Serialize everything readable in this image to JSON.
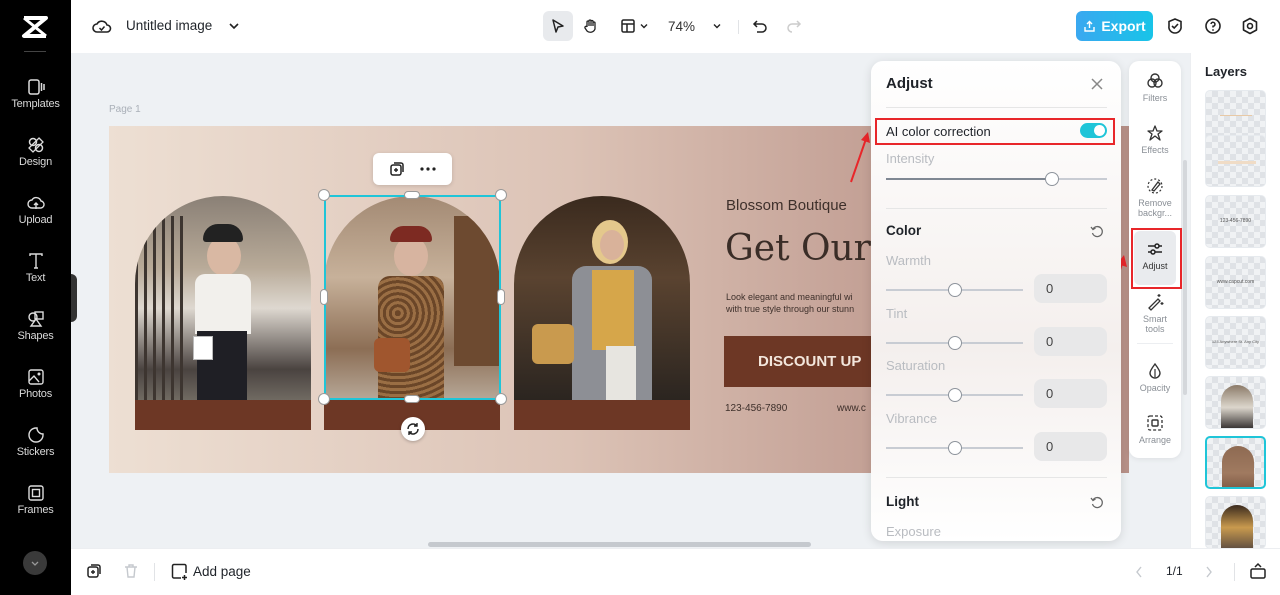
{
  "app": {
    "logo": "capcut-logo-icon"
  },
  "rail": {
    "items": [
      {
        "label": "Templates",
        "icon": "templates-icon"
      },
      {
        "label": "Design",
        "icon": "design-icon"
      },
      {
        "label": "Upload",
        "icon": "upload-cloud-icon"
      },
      {
        "label": "Text",
        "icon": "text-icon"
      },
      {
        "label": "Shapes",
        "icon": "shapes-icon"
      },
      {
        "label": "Photos",
        "icon": "photos-icon"
      },
      {
        "label": "Stickers",
        "icon": "stickers-icon"
      },
      {
        "label": "Frames",
        "icon": "frames-icon"
      }
    ]
  },
  "topbar": {
    "title": "Untitled image",
    "zoom": "74%",
    "export_label": "Export"
  },
  "canvas": {
    "page_label": "Page 1",
    "design": {
      "brand": "Blossom Boutique",
      "headline": "Get Our",
      "body_line1": "Look elegant and meaningful wi",
      "body_line2": "with true style through our stunn",
      "cta": "DISCOUNT UP",
      "phone": "123-456-7890",
      "website": "www.c"
    }
  },
  "adjust_panel": {
    "title": "Adjust",
    "ai_color_correction": {
      "label": "AI color correction",
      "enabled": true
    },
    "intensity": {
      "label": "Intensity",
      "value_fraction": 0.75
    },
    "color": {
      "title": "Color",
      "sliders": [
        {
          "label": "Warmth",
          "value": "0"
        },
        {
          "label": "Tint",
          "value": "0"
        },
        {
          "label": "Saturation",
          "value": "0"
        },
        {
          "label": "Vibrance",
          "value": "0"
        }
      ]
    },
    "light": {
      "title": "Light",
      "first_label": "Exposure"
    }
  },
  "tool_strip": {
    "items": [
      {
        "label": "Filters",
        "icon": "filters-icon"
      },
      {
        "label": "Effects",
        "icon": "effects-icon"
      },
      {
        "label": "Remove backgr...",
        "label_line1": "Remove",
        "label_line2": "backgr...",
        "icon": "remove-background-icon"
      },
      {
        "label": "Adjust",
        "icon": "adjust-sliders-icon",
        "active": true
      },
      {
        "label": "Smart tools",
        "label_line1": "Smart",
        "label_line2": "tools",
        "icon": "magic-wand-icon"
      },
      {
        "label": "Opacity",
        "icon": "opacity-drop-icon"
      },
      {
        "label": "Arrange",
        "icon": "arrange-icon"
      }
    ]
  },
  "layers": {
    "title": "Layers",
    "items": [
      {
        "type": "text",
        "text": ""
      },
      {
        "type": "text",
        "text": ""
      },
      {
        "type": "text",
        "text": "123-456-7890"
      },
      {
        "type": "text",
        "text": "www.capcut.com"
      },
      {
        "type": "text",
        "text": "123 Anywhere St. Any City"
      },
      {
        "type": "image",
        "text": ""
      },
      {
        "type": "image",
        "text": "",
        "selected": true
      },
      {
        "type": "image",
        "text": ""
      }
    ]
  },
  "bottombar": {
    "add_page_label": "Add page",
    "page_indicator": "1/1"
  },
  "colors": {
    "accent": "#1fc5d8",
    "export_gradient_start": "#3aa8f0",
    "brand_brown": "#6d3725",
    "annotation_red": "#e8262a"
  }
}
